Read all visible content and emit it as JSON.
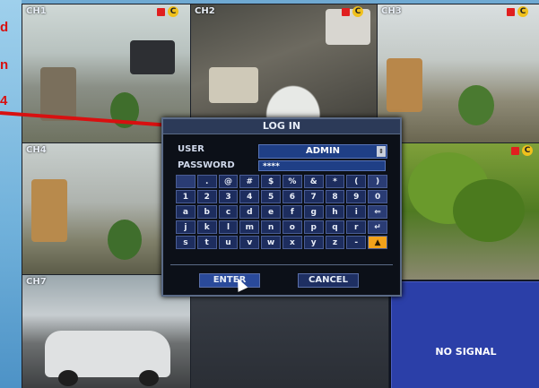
{
  "annotation": {
    "lines": [
      "d",
      "n",
      "4"
    ],
    "color": "#d81010"
  },
  "cameras": [
    {
      "label": "CH1",
      "rec": true,
      "badge": "C"
    },
    {
      "label": "CH2",
      "rec": true,
      "badge": "C"
    },
    {
      "label": "CH3",
      "rec": true,
      "badge": "C"
    },
    {
      "label": "CH4",
      "rec": false,
      "badge": ""
    },
    {
      "label": "",
      "rec": true,
      "badge": "C"
    },
    {
      "label": "CH7",
      "rec": false,
      "badge": ""
    }
  ],
  "no_signal": {
    "text": "NO SIGNAL"
  },
  "login": {
    "title": "LOG IN",
    "user_label": "USER",
    "user_value": "ADMIN",
    "password_label": "PASSWORD",
    "password_value": "****",
    "enter_label": "ENTER",
    "cancel_label": "CANCEL",
    "keys": [
      [
        "",
        ".",
        "@",
        "#",
        "$",
        "%",
        "&",
        "*",
        "(",
        ")"
      ],
      [
        "1",
        "2",
        "3",
        "4",
        "5",
        "6",
        "7",
        "8",
        "9",
        "0"
      ],
      [
        "a",
        "b",
        "c",
        "d",
        "e",
        "f",
        "g",
        "h",
        "i",
        "⇐"
      ],
      [
        "j",
        "k",
        "l",
        "m",
        "n",
        "o",
        "p",
        "q",
        "r",
        "↵"
      ],
      [
        "s",
        "t",
        "u",
        "v",
        "w",
        "x",
        "y",
        "z",
        "-",
        "▲"
      ]
    ]
  },
  "colors": {
    "accent": "#f2a21a",
    "dialog_bg": "#0c1018",
    "field_bg": "#1f3f86",
    "no_signal_bg": "#2b3fa8"
  }
}
